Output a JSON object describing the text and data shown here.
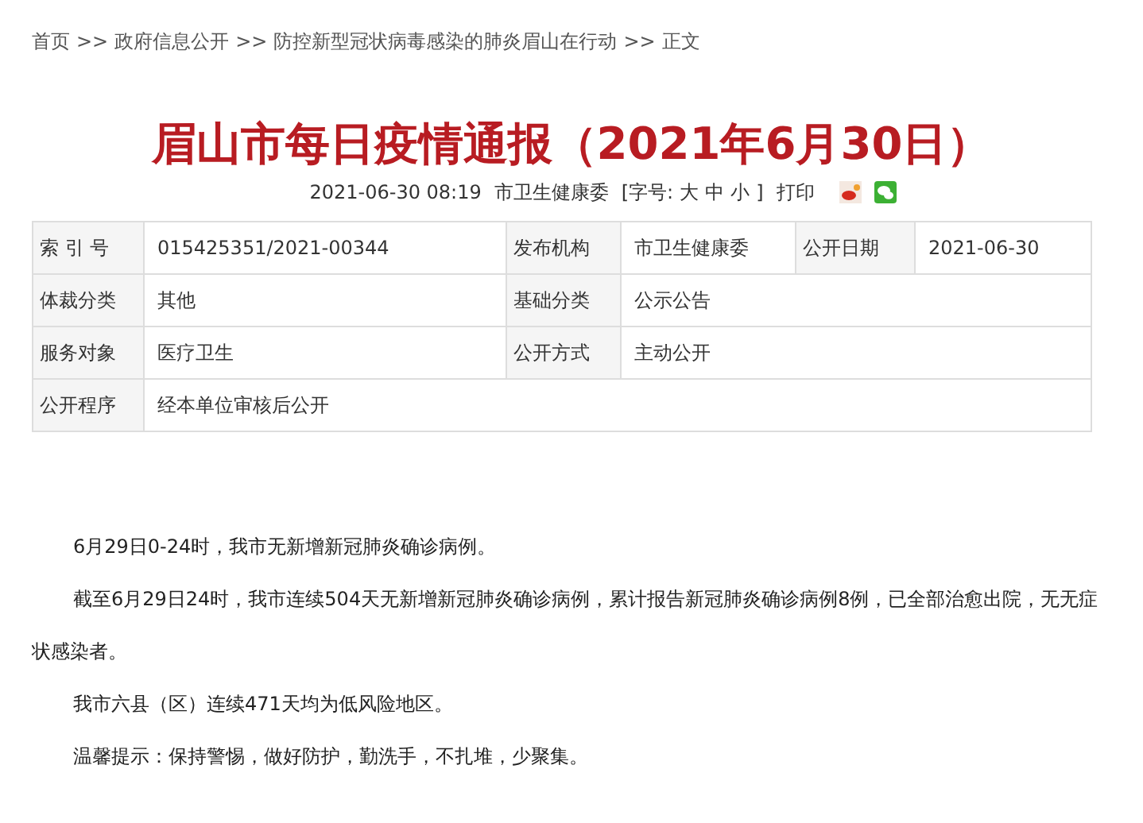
{
  "breadcrumb": [
    "首页",
    ">>",
    "政府信息公开",
    ">>",
    "防控新型冠状病毒感染的肺炎眉山在行动",
    ">>",
    "正文"
  ],
  "title": "眉山市每日疫情通报（2021年6月30日）",
  "meta": {
    "datetime": "2021-06-30 08:19",
    "source": "市卫生健康委",
    "font_size_open": "[字号:",
    "sizes": [
      "大",
      "中",
      "小"
    ],
    "font_size_close": "]",
    "print": "打印"
  },
  "info_table": [
    [
      {
        "label": "索 引 号",
        "value": "015425351/2021-00344"
      },
      {
        "label": "发布机构",
        "value": "市卫生健康委"
      },
      {
        "label": "公开日期",
        "value": "2021-06-30"
      }
    ],
    [
      {
        "label": "体裁分类",
        "value": "其他"
      },
      {
        "label": "基础分类",
        "value": "公示公告"
      }
    ],
    [
      {
        "label": "服务对象",
        "value": "医疗卫生"
      },
      {
        "label": "公开方式",
        "value": "主动公开"
      }
    ],
    [
      {
        "label": "公开程序",
        "value": "经本单位审核后公开"
      }
    ]
  ],
  "paragraphs": [
    "6月29日0-24时，我市无新增新冠肺炎确诊病例。",
    "截至6月29日24时，我市连续504天无新增新冠肺炎确诊病例，累计报告新冠肺炎确诊病例8例，已全部治愈出院，无无症状感染者。",
    "我市六县（区）连续471天均为低风险地区。",
    "温馨提示：保持警惕，做好防护，勤洗手，不扎堆，少聚集。"
  ]
}
